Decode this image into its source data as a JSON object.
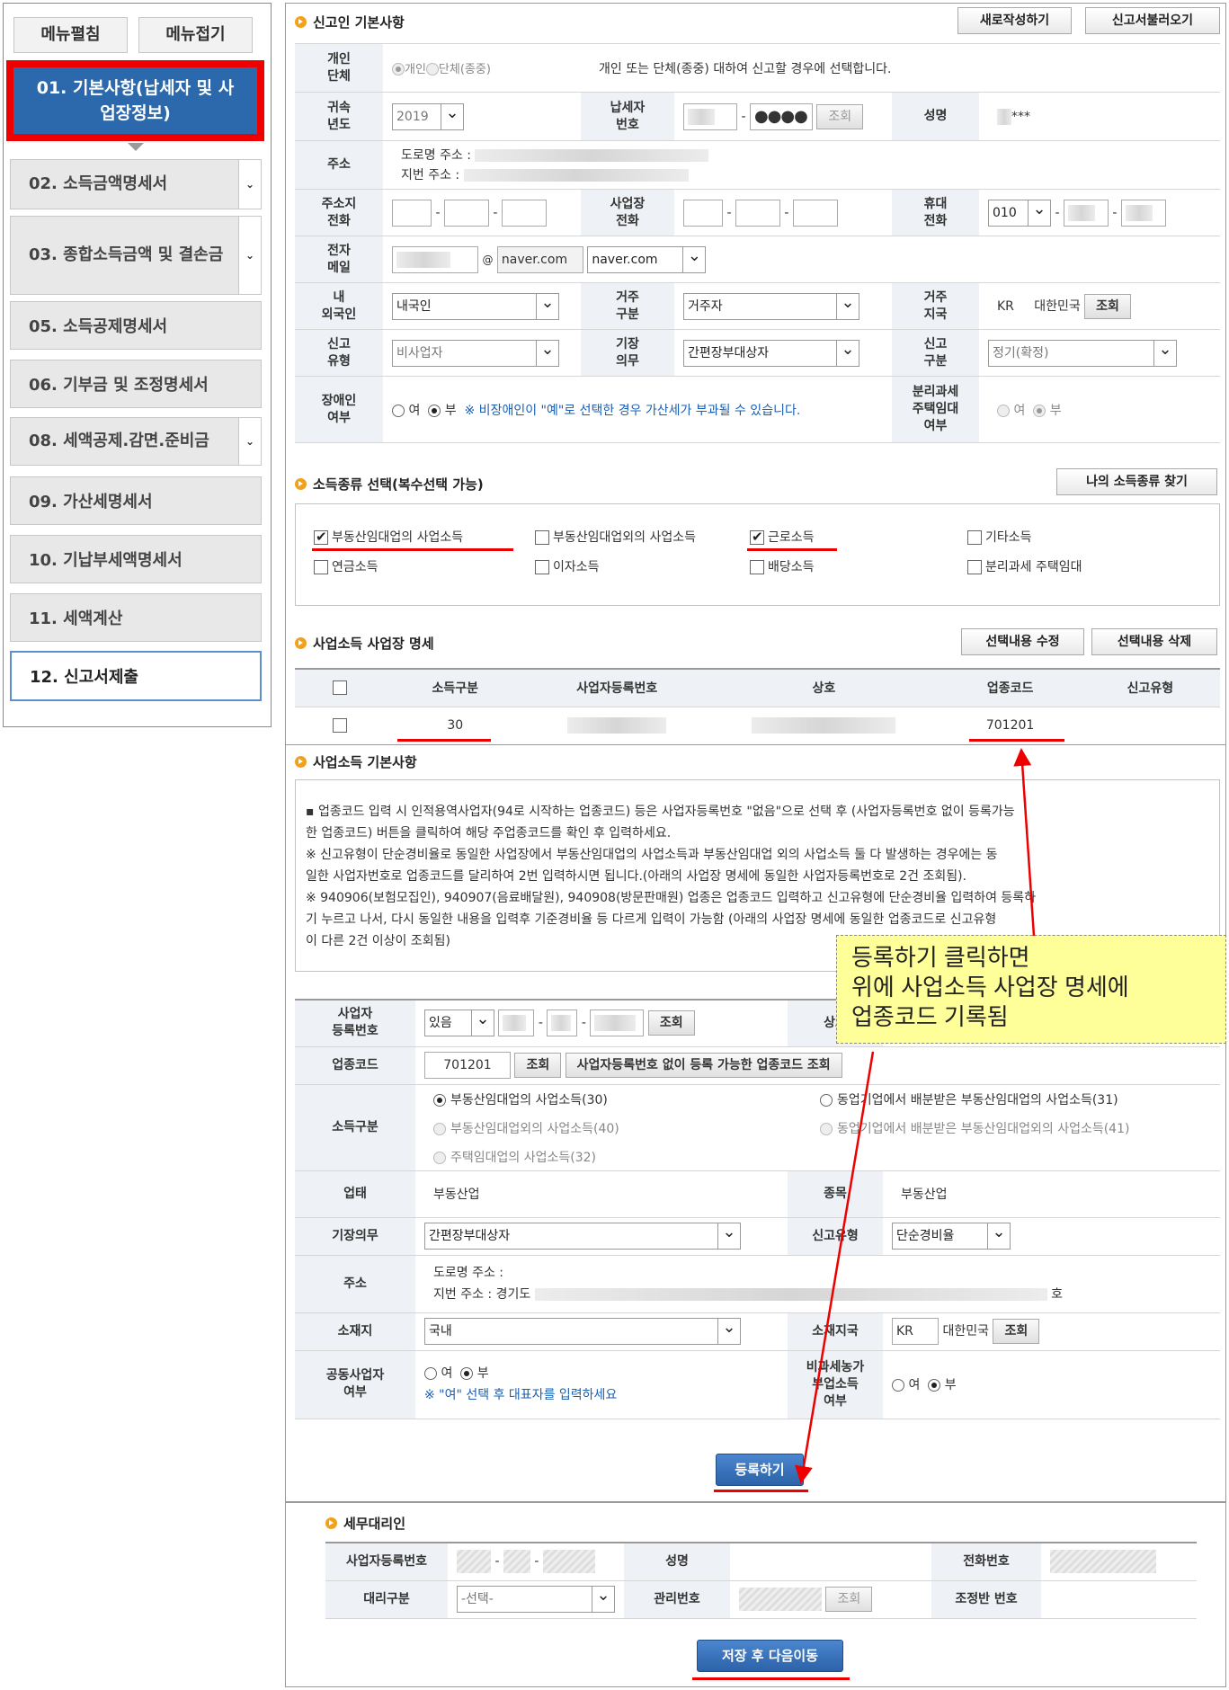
{
  "sidebar": {
    "expand_label": "메뉴펼침",
    "collapse_label": "메뉴접기",
    "active_step": "01. 기본사항(납세자 및 사업장정보)",
    "steps": [
      {
        "label": "02. 소득금액명세서",
        "dropdown": true
      },
      {
        "label": "03. 종합소득금액 및 결손금",
        "dropdown": true
      },
      {
        "label": "05. 소득공제명세서",
        "dropdown": false
      },
      {
        "label": "06. 기부금 및 조정명세서",
        "dropdown": false
      },
      {
        "label": "08. 세액공제.감면.준비금",
        "dropdown": true
      },
      {
        "label": "09. 가산세명세서",
        "dropdown": false
      },
      {
        "label": "10. 기납부세액명세서",
        "dropdown": false
      },
      {
        "label": "11. 세액계산",
        "dropdown": false
      },
      {
        "label": "12. 신고서제출",
        "dropdown": false
      }
    ]
  },
  "reporter": {
    "title": "신고인 기본사항",
    "new_button": "새로작성하기",
    "load_button": "신고서불러오기",
    "individual_label": "개인\n단체",
    "individual_opt": "개인",
    "group_opt": "단체(종중)",
    "individual_note": "개인 또는 단체(종중) 대하여 신고할 경우에 선택합니다.",
    "year_label": "귀속\n년도",
    "year_value": "2019",
    "taxpayer_no_label": "납세자\n번호",
    "taxpayer_no_mask": "●●●●",
    "lookup": "조회",
    "name_label": "성명",
    "name_value": "***",
    "address_label": "주소",
    "road_address": "도로명 주소 :",
    "lot_address": "지번 주소 :",
    "home_phone_label": "주소지\n전화",
    "biz_phone_label": "사업장\n전화",
    "mobile_label": "휴대\n전화",
    "mobile_prefix": "010",
    "email_label": "전자\n메일",
    "email_at": "@",
    "email_domain": "naver.com",
    "email_domain_select": "naver.com",
    "nationality_label": "내\n외국인",
    "nationality_value": "내국인",
    "residence_type_label": "거주\n구분",
    "residence_type_value": "거주자",
    "residence_country_label": "거주\n지국",
    "residence_country_code": "KR",
    "residence_country_name": "대한민국",
    "report_type_label": "신고\n유형",
    "report_type_value": "비사업자",
    "bookkeeping_label": "기장\n의무",
    "bookkeeping_value": "간편장부대상자",
    "report_class_label": "신고\n구분",
    "report_class_value": "정기(확정)",
    "disabled_label": "장애인\n여부",
    "yes": "여",
    "no": "부",
    "disabled_note": "※ 비장애인이 \"예\"로 선택한 경우 가산세가 부과될 수 있습니다.",
    "separate_tax_label": "분리과세\n주택임대\n여부"
  },
  "income_types": {
    "title": "소득종류 선택(복수선택 가능)",
    "find_button": "나의 소득종류 찾기",
    "items": [
      {
        "label": "부동산임대업의 사업소득",
        "checked": true
      },
      {
        "label": "부동산임대업외의 사업소득",
        "checked": false
      },
      {
        "label": "근로소득",
        "checked": true
      },
      {
        "label": "기타소득",
        "checked": false
      },
      {
        "label": "연금소득",
        "checked": false
      },
      {
        "label": "이자소득",
        "checked": false
      },
      {
        "label": "배당소득",
        "checked": false
      },
      {
        "label": "분리과세 주택임대",
        "checked": false
      }
    ]
  },
  "biz_list": {
    "title": "사업소득 사업장 명세",
    "edit_button": "선택내용 수정",
    "delete_button": "선택내용 삭제",
    "headers": [
      "소득구분",
      "사업자등록번호",
      "상호",
      "업종코드",
      "신고유형"
    ],
    "row": {
      "income_class": "30",
      "industry_code": "701201"
    }
  },
  "biz_basic": {
    "title": "사업소득 기본사항",
    "notes": [
      "▪ 업종코드 입력 시 인적용역사업자(94로 시작하는 업종코드) 등은 사업자등록번호 \"없음\"으로 선택 후 (사업자등록번호 없이 등록가능",
      "한 업종코드) 버튼을 클릭하여 해당 주업종코드를 확인 후 입력하세요.",
      "※ 신고유형이 단순경비율로 동일한 사업장에서 부동산임대업의 사업소득과 부동산임대업 외의 사업소득 둘 다 발생하는 경우에는 동",
      "일한 사업자번호로 업종코드를 달리하여 2번 입력하시면 됩니다.(아래의 사업장 명세에 동일한 사업자등록번호로 2건 조회됨).",
      "※ 940906(보험모집인), 940907(음료배달원), 940908(방문판매원) 업종은 업종코드 입력하고 신고유형에 단순경비율 입력하여 등록하",
      "기 누르고 나서, 다시 동일한 내용을 입력후 기준경비율 등 다르게 입력이 가능함 (아래의 사업장 명세에 동일한 업종코드로 신고유형",
      "이 다른 2건 이상이 조회됨)"
    ],
    "callout": [
      "등록하기 클릭하면",
      "위에 사업소득 사업장 명세에",
      "업종코드 기록됨"
    ],
    "reg_no_label": "사업자\n등록번호",
    "reg_no_select": "있음",
    "trade_name_label": "상호",
    "industry_code_label": "업종코드",
    "industry_code_value": "701201",
    "no_reg_lookup": "사업자등록번호 없이 등록 가능한 업종코드 조회",
    "income_class_label": "소득구분",
    "income_options": [
      {
        "label": "부동산임대업의 사업소득(30)",
        "selected": true,
        "enabled": true
      },
      {
        "label": "동업기업에서 배분받은 부동산임대업의 사업소득(31)",
        "selected": false,
        "enabled": true
      },
      {
        "label": "부동산임대업외의 사업소득(40)",
        "selected": false,
        "enabled": false
      },
      {
        "label": "동업기업에서 배분받은 부동산임대업외의 사업소득(41)",
        "selected": false,
        "enabled": false
      },
      {
        "label": "주택임대업의 사업소득(32)",
        "selected": false,
        "enabled": false
      }
    ],
    "business_type_label": "업태",
    "business_type_value": "부동산업",
    "item_label": "종목",
    "item_value": "부동산업",
    "bookkeeping_label": "기장의무",
    "bookkeeping_value": "간편장부대상자",
    "report_type_label": "신고유형",
    "report_type_value": "단순경비율",
    "address_label": "주소",
    "road_address": "도로명 주소 :",
    "lot_address": "지번 주소 :",
    "lot_address_city": "경기도",
    "lot_address_suffix": "호",
    "location_label": "소재지",
    "location_value": "국내",
    "location_country_label": "소재지국",
    "location_country_code": "KR",
    "location_country_name": "대한민국",
    "joint_label": "공동사업자\n여부",
    "joint_note": "※ \"여\" 선택 후 대표자를 입력하세요",
    "nontax_label": "비과세농가\n부업소득\n여부",
    "register_button": "등록하기"
  },
  "agent": {
    "title": "세무대리인",
    "reg_no_label": "사업자등록번호",
    "name_label": "성명",
    "phone_label": "전화번호",
    "class_label": "대리구분",
    "class_select": "-선택-",
    "manage_no_label": "관리번호",
    "adjust_no_label": "조정반 번호",
    "save_next": "저장 후 다음이동"
  },
  "colors": {
    "active_step": "#2b68ac",
    "highlight": "#ee0000",
    "callout": "#ffff99",
    "primary": "#2c62a8"
  }
}
